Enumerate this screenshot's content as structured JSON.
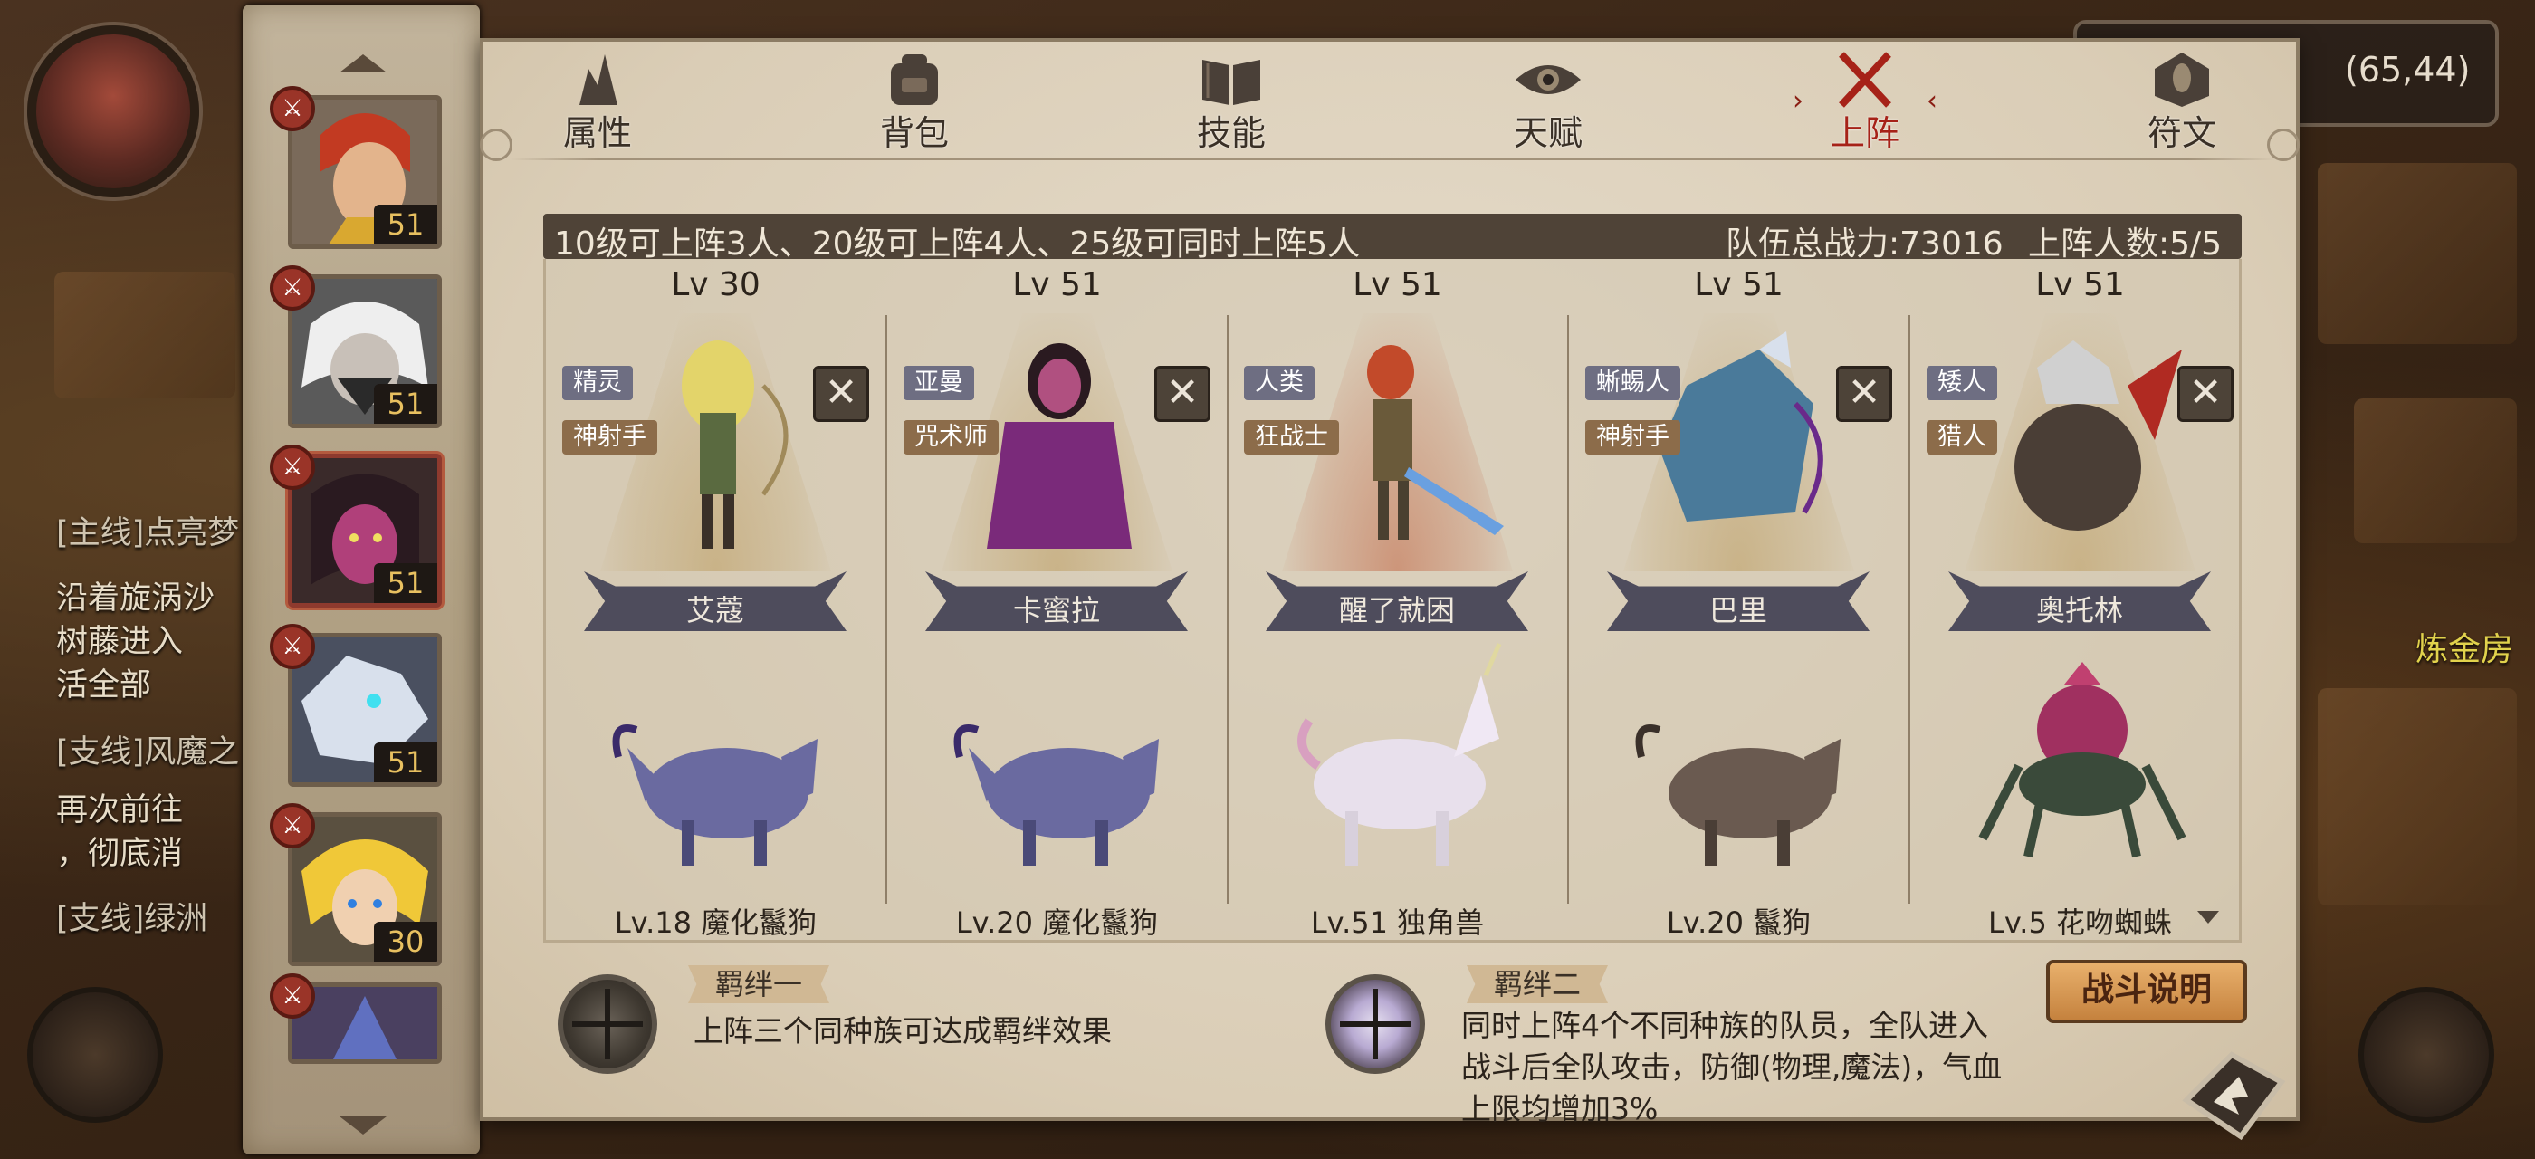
{
  "hud": {
    "coordinates": "(65,44)",
    "alchemy_room": "炼金房",
    "quests": [
      {
        "text": "[主线]点亮梦",
        "tag": true
      },
      {
        "text": "沿着旋涡沙",
        "tag": false
      },
      {
        "text": "树藤进入",
        "tag": false
      },
      {
        "text": "活全部",
        "tag": false
      },
      {
        "text": "[支线]风魔之",
        "tag": true
      },
      {
        "text": "再次前往",
        "tag": false
      },
      {
        "text": "，彻底消",
        "tag": false
      },
      {
        "text": "[支线]绿洲",
        "tag": true
      }
    ]
  },
  "hero_rail": {
    "heroes": [
      {
        "level": "51",
        "selected": false,
        "hair": "#c23a22",
        "skin": "#e3b48c"
      },
      {
        "level": "51",
        "selected": false,
        "hair": "#e8e8e8",
        "skin": "#d0c8c0"
      },
      {
        "level": "51",
        "selected": true,
        "hair": "#2a1a20",
        "skin": "#b0407a"
      },
      {
        "level": "51",
        "selected": false,
        "hair": "#d8e0ec",
        "skin": "#8aa0c0"
      },
      {
        "level": "30",
        "selected": false,
        "hair": "#f0c838",
        "skin": "#f0d0b0"
      },
      {
        "level": "",
        "selected": false,
        "hair": "#6070c0",
        "skin": "#e0c090"
      }
    ]
  },
  "tabs": [
    {
      "label": "属性",
      "icon": "flame-icon",
      "active": false
    },
    {
      "label": "背包",
      "icon": "backpack-icon",
      "active": false
    },
    {
      "label": "技能",
      "icon": "book-icon",
      "active": false
    },
    {
      "label": "天赋",
      "icon": "talent-eye-icon",
      "active": false
    },
    {
      "label": "上阵",
      "icon": "crossed-swords-icon",
      "active": true
    },
    {
      "label": "符文",
      "icon": "rune-icon",
      "active": false
    }
  ],
  "team": {
    "rule_text": "10级可上阵3人、20级可上阵4人、25级可同时上阵5人",
    "total_power": "队伍总战力:73016",
    "deployed_count": "上阵人数:5/5"
  },
  "slots": [
    {
      "level": "Lv 30",
      "race": "精灵",
      "class": "神射手",
      "name": "艾蔻",
      "pet": "Lv.18 魔化鬣狗",
      "hero_color": "#e3d46a",
      "pet_color": "#6a6aa0"
    },
    {
      "level": "Lv 51",
      "race": "亚曼",
      "class": "咒术师",
      "name": "卡蜜拉",
      "hero_color": "#7a2a7a",
      "pet": "Lv.20 魔化鬣狗",
      "pet_color": "#6a6aa0"
    },
    {
      "level": "Lv 51",
      "race": "人类",
      "class": "狂战士",
      "name": "醒了就困",
      "hero_color": "#c24a2a",
      "pet": "Lv.51 独角兽",
      "pet_color": "#e8e0ec"
    },
    {
      "level": "Lv 51",
      "race": "蜥蜴人",
      "class": "神射手",
      "name": "巴里",
      "hero_color": "#4a7a9a",
      "pet": "Lv.20 鬣狗",
      "pet_color": "#6a5a50"
    },
    {
      "level": "Lv 51",
      "race": "矮人",
      "class": "猎人",
      "name": "奥托林",
      "hero_color": "#b0b0b0",
      "pet": "Lv.5 花吻蜘蛛",
      "pet_color": "#a03060"
    }
  ],
  "bonds": {
    "bond1_title": "羁绊一",
    "bond1_desc": "上阵三个同种族可达成羁绊效果",
    "bond2_title": "羁绊二",
    "bond2_desc_1": "同时上阵4个不同种族的队员，全队进入",
    "bond2_desc_2": "战斗后全队攻击，防御(物理,魔法)，气血",
    "bond2_desc_3": "上限均增加3%"
  },
  "battle_help_label": "战斗说明",
  "colors": {
    "panel_bg": "#dacdb6",
    "active_tab": "#a62218",
    "team_bar": "#4f4337",
    "button_gold": "#e8b06c"
  }
}
